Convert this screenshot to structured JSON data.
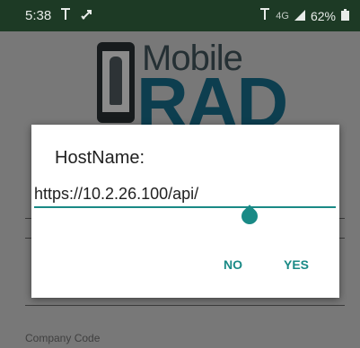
{
  "status_bar": {
    "time": "5:38",
    "battery": "62%",
    "network": "4G",
    "icons": [
      "antenna-icon",
      "bell-icon",
      "signal-icon",
      "battery-icon"
    ]
  },
  "logo": {
    "line1": "Mobile",
    "line2": "RAD"
  },
  "background": {
    "company_code_label": "Company Code"
  },
  "dialog": {
    "title": "HostName:",
    "host_value": "https://10.2.26.100/api/",
    "no_label": "NO",
    "yes_label": "YES"
  },
  "colors": {
    "status_bar": "#1d3a25",
    "accent": "#1a8a86",
    "logo_dark": "#0d3e4f"
  }
}
